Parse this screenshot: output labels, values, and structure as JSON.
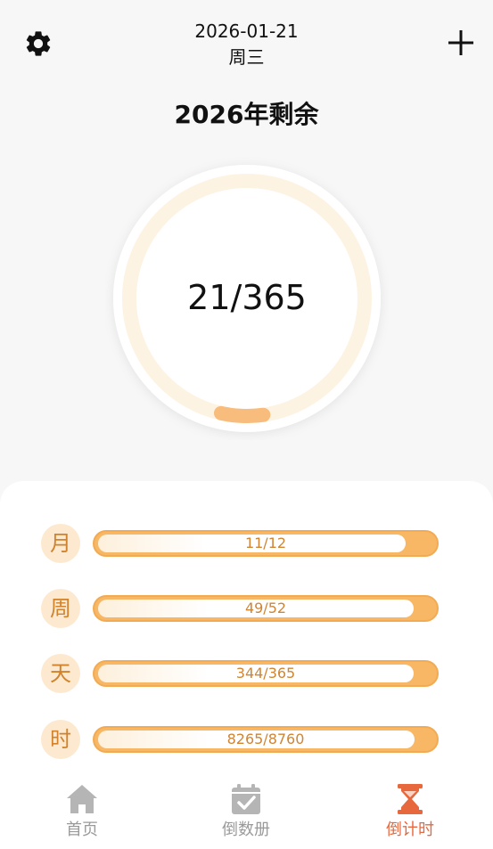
{
  "header": {
    "date": "2026-01-21",
    "weekday": "周三",
    "settings_icon": "gear-icon",
    "add_icon": "plus-icon"
  },
  "title": "2026年剩余",
  "ring": {
    "value_text": "21/365",
    "progress_fraction": 0.0575,
    "track_color": "#fdf3e3",
    "progress_color": "#f8bd7c"
  },
  "progress_rows": [
    {
      "badge": "月",
      "text": "11/12",
      "fraction": 0.9167
    },
    {
      "badge": "周",
      "text": "49/52",
      "fraction": 0.9423
    },
    {
      "badge": "天",
      "text": "344/365",
      "fraction": 0.9425
    },
    {
      "badge": "时",
      "text": "8265/8760",
      "fraction": 0.9435
    }
  ],
  "tabs": [
    {
      "label": "首页",
      "icon": "home-icon",
      "active": false
    },
    {
      "label": "倒数册",
      "icon": "calendar-check-icon",
      "active": false
    },
    {
      "label": "倒计时",
      "icon": "hourglass-icon",
      "active": true
    }
  ],
  "colors": {
    "accent": "#e8683e",
    "bar": "#f7b765",
    "badge_bg": "#fde9cf",
    "badge_text": "#d0822c"
  }
}
